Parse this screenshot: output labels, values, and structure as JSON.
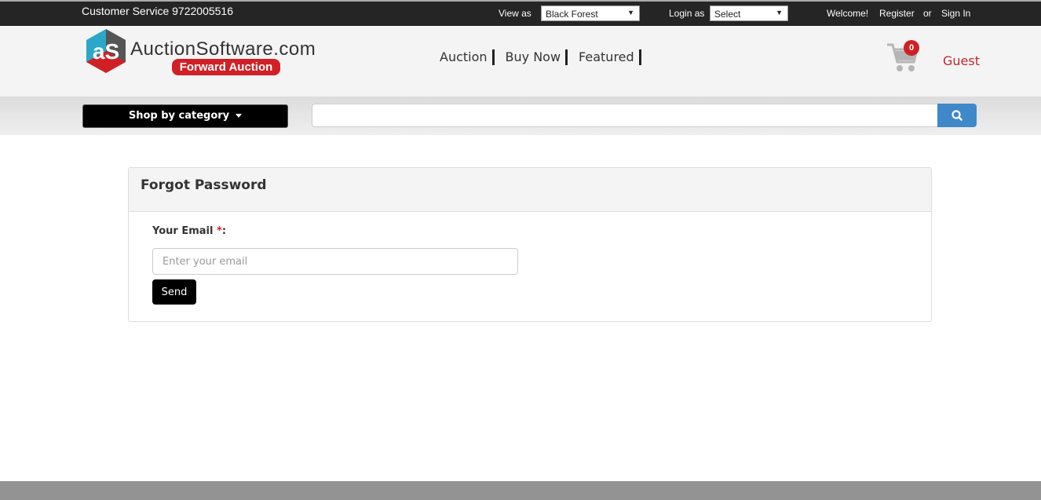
{
  "topbar": {
    "customer_service": "Customer Service 9722005516",
    "view_as_label": "View as",
    "view_as_value": "Black Forest",
    "login_as_label": "Login as",
    "login_as_value": "Select",
    "welcome": "Welcome!",
    "register": "Register",
    "or": "or",
    "sign_in": "Sign In"
  },
  "header": {
    "logo_text": "AuctionSoftware.com",
    "logo_badge": "Forward Auction",
    "nav": [
      {
        "label": "Auction"
      },
      {
        "label": "Buy Now"
      },
      {
        "label": "Featured"
      }
    ],
    "cart_count": "0",
    "user": "Guest"
  },
  "search": {
    "category_label": "Shop by category",
    "query": "",
    "icon": "search-icon"
  },
  "panel": {
    "title": "Forgot Password",
    "email_label": "Your Email",
    "required_mark": "*",
    "colon": ":",
    "email_placeholder": "Enter your email",
    "send_label": "Send"
  },
  "colors": {
    "brand_red": "#d11f26",
    "search_blue": "#3f88c9",
    "topbar": "#252525"
  }
}
